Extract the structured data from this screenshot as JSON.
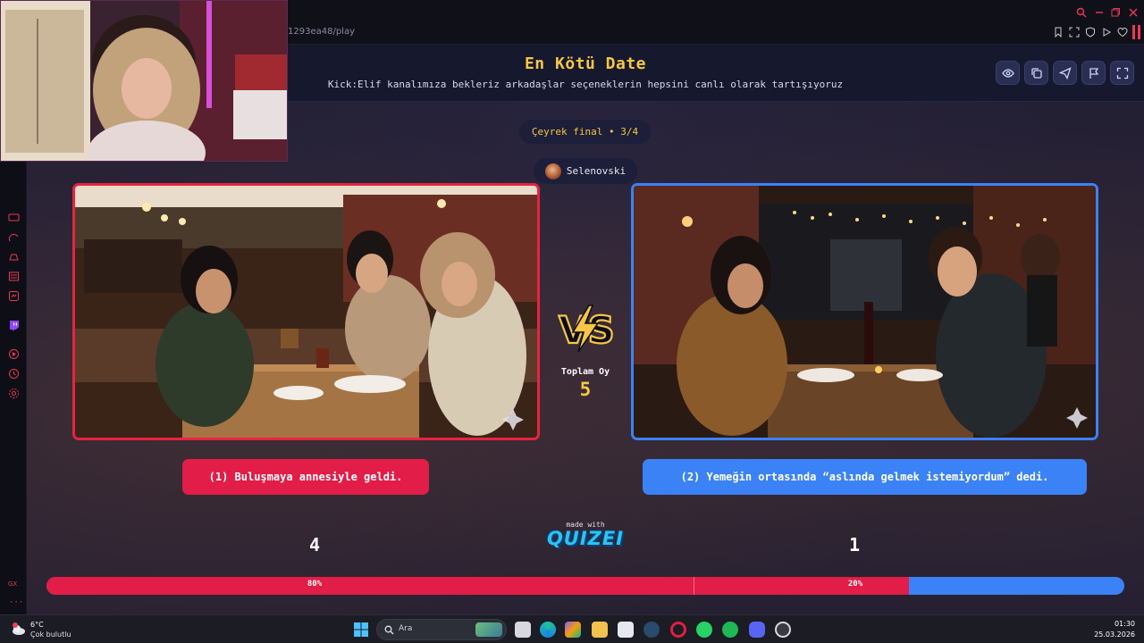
{
  "browser": {
    "url": "1293ea48/play"
  },
  "header": {
    "title": "En Kötü Date",
    "subtitle": "Kick:Elif kanalımıza bekleriz arkadaşlar seçeneklerin hepsini canlı olarak tartışıyoruz",
    "buttons": [
      "eye-icon",
      "copy-icon",
      "send-icon",
      "flag-icon",
      "fullscreen-icon"
    ]
  },
  "round": {
    "label": "Çeyrek final • 3/4"
  },
  "author": {
    "name": "Selenovski"
  },
  "vs": {
    "label": "VS"
  },
  "votes": {
    "label": "Toplam Oy",
    "total": "5"
  },
  "options": {
    "left": {
      "text": "(1) Buluşmaya annesiyle geldi.",
      "votes": "4",
      "percent": "80%",
      "color": "#e11d48"
    },
    "right": {
      "text": "(2) Yemeğin ortasında “aslında gelmek istemiyordum” dedi.",
      "votes": "1",
      "percent": "20%",
      "color": "#3b82f6"
    }
  },
  "progress": {
    "left_fraction": 0.8
  },
  "branding": {
    "made_with": "made with",
    "logo": "QUIZEI"
  },
  "taskbar": {
    "weather": {
      "temp": "6°C",
      "desc": "Çok bulutlu"
    },
    "search_placeholder": "Ara",
    "time": "01:30",
    "date": "25.03.2026",
    "apps": [
      "windows-icon",
      "task-view-icon",
      "edge-icon",
      "copilot-icon",
      "file-explorer-icon",
      "store-icon",
      "steam-icon",
      "opera-gx-icon",
      "whatsapp-icon",
      "spotify-icon",
      "discord-icon",
      "obs-icon"
    ]
  },
  "sidebar": {
    "label": "GX"
  }
}
